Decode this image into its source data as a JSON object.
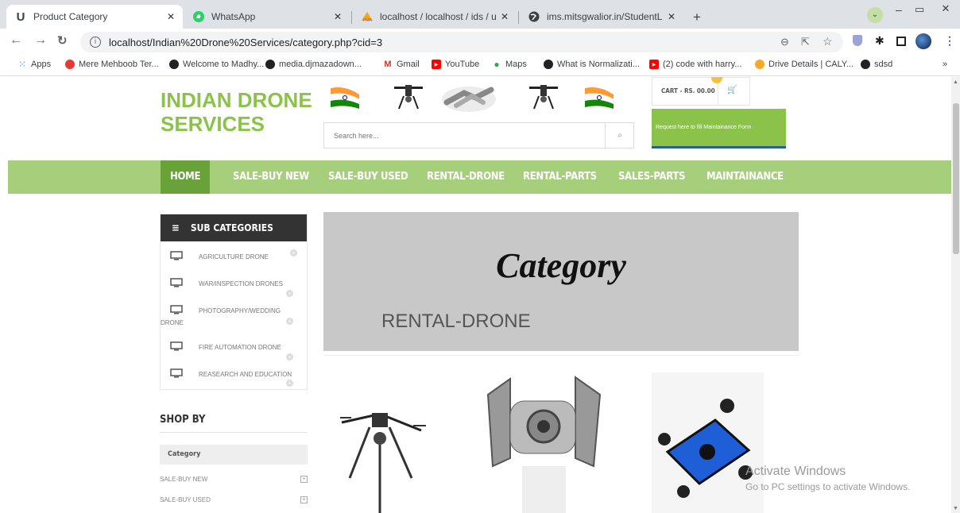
{
  "browser": {
    "tabs": [
      {
        "title": "Product Category",
        "icon": "u-logo-icon",
        "active": true
      },
      {
        "title": "WhatsApp",
        "icon": "whatsapp-icon",
        "active": false
      },
      {
        "title": "localhost / localhost / ids / userlc",
        "icon": "phpmyadmin-icon",
        "active": false
      },
      {
        "title": "ims.mitsgwalior.in/StudentLife/Re",
        "icon": "globe-icon",
        "active": false
      }
    ],
    "url": "localhost/Indian%20Drone%20Services/category.php?cid=3",
    "bookmarks": [
      {
        "label": "Apps",
        "color": "#4285f4"
      },
      {
        "label": "Mere Mehboob Ter...",
        "color": "#e53935"
      },
      {
        "label": "Welcome to Madhy...",
        "color": "#202124"
      },
      {
        "label": "media.djmazadown...",
        "color": "#202124"
      },
      {
        "label": "Gmail",
        "color": "#d93025"
      },
      {
        "label": "YouTube",
        "color": "#ff0000"
      },
      {
        "label": "Maps",
        "color": "#34a853"
      },
      {
        "label": "What is Normalizati...",
        "color": "#202124"
      },
      {
        "label": "(2) code with harry...",
        "color": "#ff0000"
      },
      {
        "label": "Drive Details | CALY...",
        "color": "#f9a825"
      },
      {
        "label": "sdsd",
        "color": "#202124"
      }
    ],
    "more_bookmarks": "»"
  },
  "site": {
    "logo_line1": "INDIAN DRONE",
    "logo_line2": "SERVICES",
    "search_placeholder": "Search here...",
    "cart_label": "CART - RS. 00.00",
    "maintenance_button": "Request here to fill Maintainance Form",
    "nav": [
      "HOME",
      "SALE-BUY NEW",
      "SALE-BUY USED",
      "RENTAL-DRONE",
      "RENTAL-PARTS",
      "SALES-PARTS",
      "MAINTAINANCE"
    ],
    "sub_categories_title": "SUB CATEGORIES",
    "sub_categories": [
      "AGRICULTURE DRONE",
      "WAR/INSPECTION DRONES",
      "PHOTOGRAPHY/WEDDING DRONE",
      "FIRE AUTOMATION DRONE",
      "REASEARCH AND EDUCATION"
    ],
    "shop_by_title": "SHOP BY",
    "shop_by_category_label": "Category",
    "shop_by_items": [
      "SALE-BUY NEW",
      "SALE-BUY USED"
    ],
    "banner_title": "Category",
    "banner_subtitle": "RENTAL-DRONE"
  },
  "watermark": {
    "line1": "Activate Windows",
    "line2": "Go to PC settings to activate Windows."
  },
  "colors": {
    "brand_green": "#8bc34a",
    "nav_bg": "#a5cf7a",
    "nav_active": "#6aa23a",
    "dark": "#333333"
  }
}
